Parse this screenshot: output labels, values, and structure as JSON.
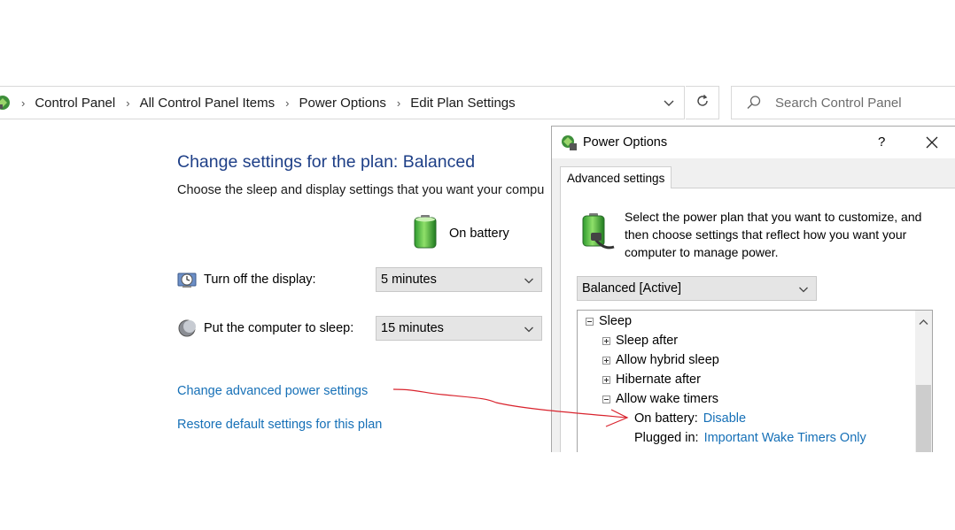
{
  "breadcrumb": {
    "items": [
      "Control Panel",
      "All Control Panel Items",
      "Power Options",
      "Edit Plan Settings"
    ]
  },
  "search": {
    "placeholder": "Search Control Panel"
  },
  "main": {
    "title": "Change settings for the plan: Balanced",
    "subtitle": "Choose the sleep and display settings that you want your compu",
    "column_header": "On battery",
    "display_label": "Turn off the display:",
    "display_value": "5 minutes",
    "sleep_label": "Put the computer to sleep:",
    "sleep_value": "15 minutes",
    "advanced_link": "Change advanced power settings",
    "restore_link": "Restore default settings for this plan"
  },
  "dialog": {
    "title": "Power Options",
    "help": "?",
    "tab": "Advanced settings",
    "description": "Select the power plan that you want to customize, and then choose settings that reflect how you want your computer to manage power.",
    "plan": "Balanced [Active]",
    "tree": {
      "sleep": "Sleep",
      "sleep_after": "Sleep after",
      "hybrid": "Allow hybrid sleep",
      "hibernate": "Hibernate after",
      "wake_timers": "Allow wake timers",
      "on_battery_label": "On battery:",
      "on_battery_value": "Disable",
      "plugged_in_label": "Plugged in:",
      "plugged_in_value": "Important Wake Timers Only"
    }
  },
  "colors": {
    "title_blue": "#1e3f87",
    "link_blue": "#1670b7",
    "annotation_red": "#d9232d"
  }
}
